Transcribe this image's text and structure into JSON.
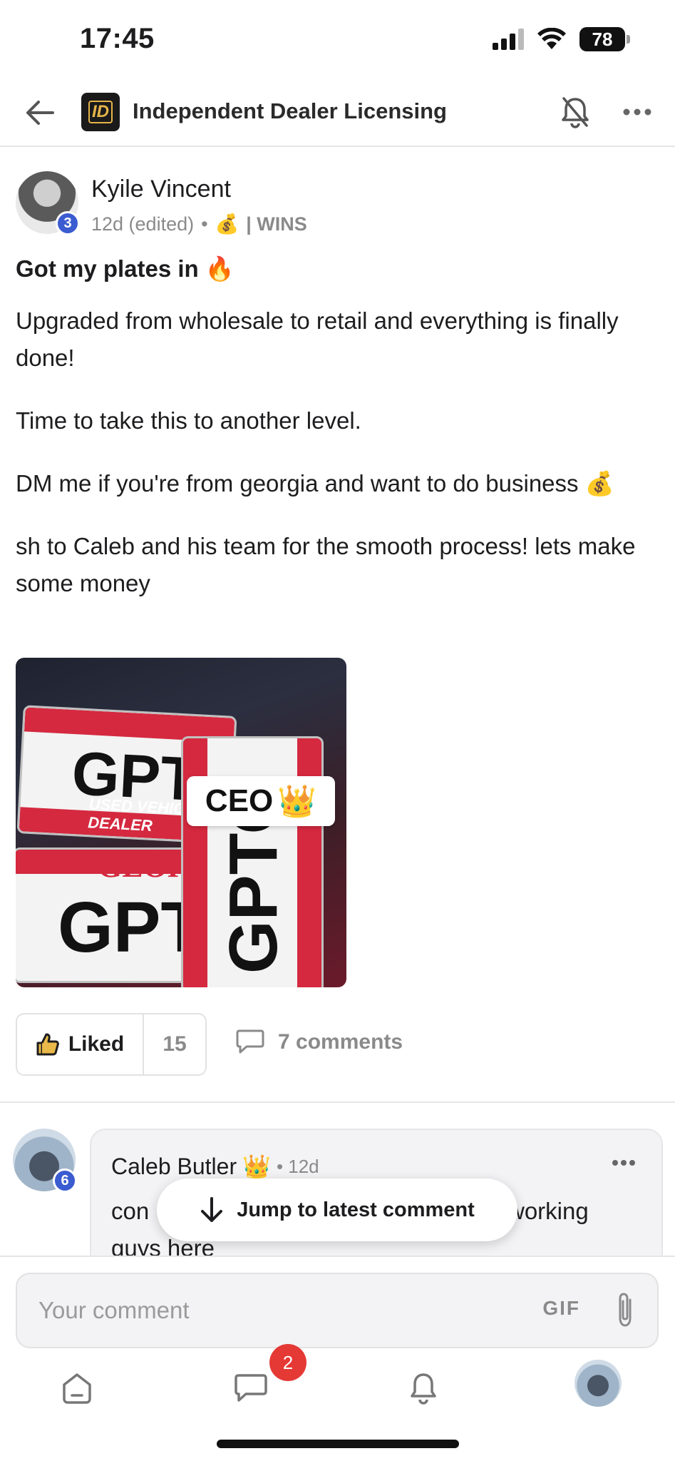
{
  "status_bar": {
    "time": "17:45",
    "battery": "78"
  },
  "header": {
    "logo_text": "ID",
    "group_name": "Independent Dealer Licensing",
    "icons": [
      "arrow-left-icon",
      "bell-off-icon",
      "more-horizontal-icon"
    ]
  },
  "post": {
    "author": "Kyile Vincent",
    "author_level": "3",
    "time": "12d (edited)",
    "separator": "•",
    "category_emoji": "💰",
    "category": "| WINS",
    "title": "Got my plates in 🔥",
    "body": [
      "Upgraded from wholesale to retail and everything is finally done!",
      "Time to take this to another level.",
      "DM me if you're from georgia and want to do business 💰",
      "sh to Caleb and his team for the smooth process! lets make some money"
    ],
    "image": {
      "plate_state": "GEORGIA",
      "plate_number": "GPTO",
      "plate_type": "USED VEHICLE DEALER",
      "overlay_text": "CEO",
      "overlay_emoji": "👑"
    },
    "like_label": "Liked",
    "like_count": "15",
    "comments_label": "7 comments"
  },
  "comment": {
    "author": "Caleb Butler",
    "author_emoji": "👑",
    "author_level": "6",
    "time": "• 12d",
    "text_start": "con",
    "text_end": "working",
    "text_line2": "guys here"
  },
  "jump_button": {
    "label": "Jump to latest comment"
  },
  "comment_input": {
    "placeholder": "Your comment",
    "gif_label": "GIF"
  },
  "bottom_nav": {
    "items": [
      "home-icon",
      "chat-icon",
      "bell-icon",
      "profile-avatar"
    ],
    "chat_badge": "2"
  },
  "colors": {
    "accent_blue": "#3b5bd1",
    "badge_red": "#e53935",
    "logo_gold": "#e5b54a"
  }
}
